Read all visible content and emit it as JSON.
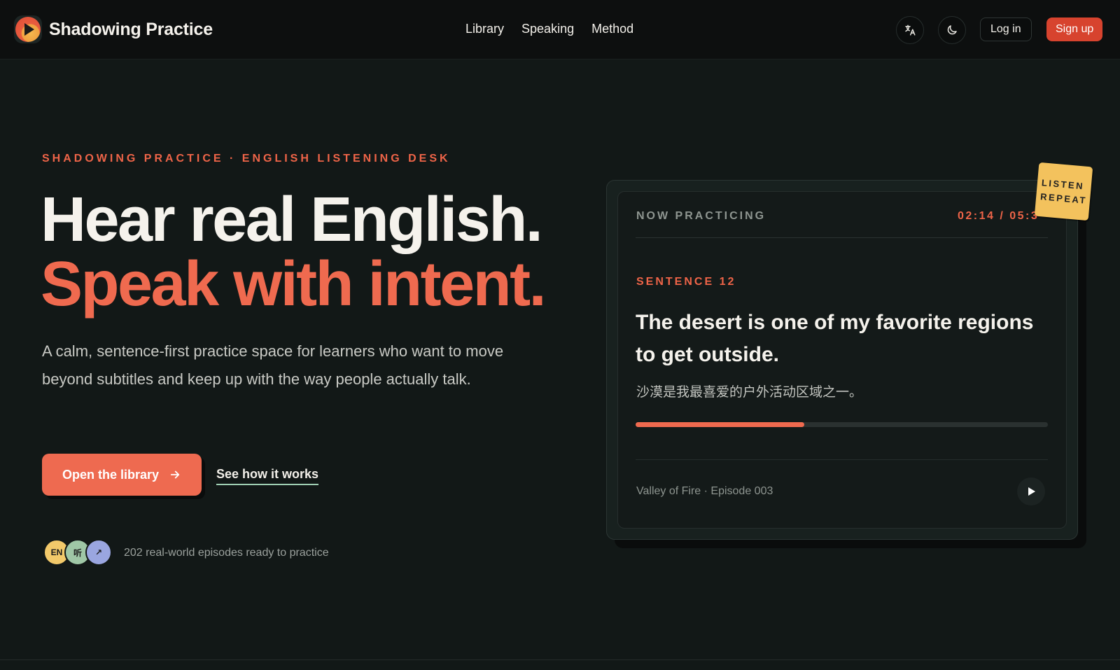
{
  "app": {
    "name": "Shadowing Practice"
  },
  "nav": {
    "items": [
      {
        "label": "Library"
      },
      {
        "label": "Speaking"
      },
      {
        "label": "Method"
      }
    ]
  },
  "header": {
    "translate_icon": "translate-icon",
    "theme_icon": "moon-icon",
    "login_label": "Log in",
    "signup_label": "Sign up"
  },
  "hero": {
    "eyebrow": "SHADOWING PRACTICE · ENGLISH LISTENING DESK",
    "headline_line1": "Hear real English.",
    "headline_line2": "Speak with intent.",
    "lede": "A calm, sentence-first practice space for learners who want to move beyond subtitles and keep up with the way people actually talk.",
    "cta_primary": "Open the library",
    "cta_primary_icon": "arrow-right-icon",
    "cta_secondary": "See how it works",
    "avatars": [
      "EN",
      "听",
      "↗"
    ],
    "social_proof": "202 real-world episodes ready to practice"
  },
  "card": {
    "now_label": "NOW PRACTICING",
    "timecode": "02:14 / 05:3",
    "sentence_label": "SENTENCE 12",
    "sentence_en": "The desert is one of my favorite regions to get outside.",
    "sentence_zh": "沙漠是我最喜爱的户外活动区域之一。",
    "progress_fraction": 0.41,
    "episode": "Valley of Fire · Episode 003",
    "play_icon": "play-icon",
    "sticker_line1": "LISTEN",
    "sticker_line2": "REPEAT"
  },
  "colors": {
    "accent": "#ee6448",
    "signup": "#d7432e",
    "background": "#121817"
  }
}
